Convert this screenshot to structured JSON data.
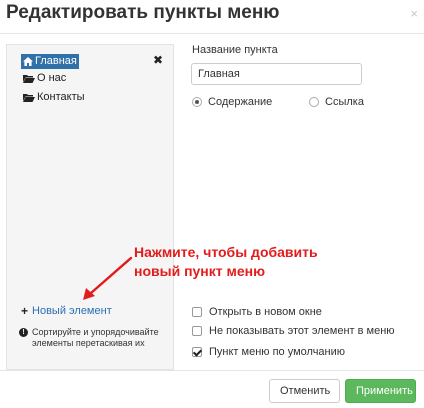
{
  "dialog": {
    "title": "Редактировать пункты меню",
    "close_label": "×"
  },
  "tree": {
    "items": [
      {
        "label": "Главная",
        "icon": "home-icon",
        "selected": true
      },
      {
        "label": "О нас",
        "icon": "folder-open-icon",
        "selected": false
      },
      {
        "label": "Контакты",
        "icon": "folder-open-icon",
        "selected": false
      }
    ],
    "delete_label": "✖",
    "add_label": "Новый элемент",
    "add_icon": "plus-icon",
    "hint": "Сортируйте и упорядочивайте элементы перетаскивая их",
    "hint_icon": "info-icon"
  },
  "form": {
    "name_label": "Название пункта",
    "name_value": "Главная",
    "radio_content": "Содержание",
    "radio_link": "Ссылка",
    "radio_selected": "content",
    "check_new_window": "Открыть в новом окне",
    "check_hide": "Не показывать этот элемент в меню",
    "check_default": "Пункт меню по умолчанию",
    "check_new_window_checked": false,
    "check_hide_checked": false,
    "check_default_checked": true
  },
  "annotation": {
    "line1": "Нажмите, чтобы добавить",
    "line2": "новый пункт меню",
    "color": "#e21c1c"
  },
  "footer": {
    "cancel_label": "Отменить",
    "apply_label": "Применить"
  },
  "colors": {
    "accent": "#3071a9",
    "apply": "#5cb85c",
    "link": "#2a6fb5"
  }
}
